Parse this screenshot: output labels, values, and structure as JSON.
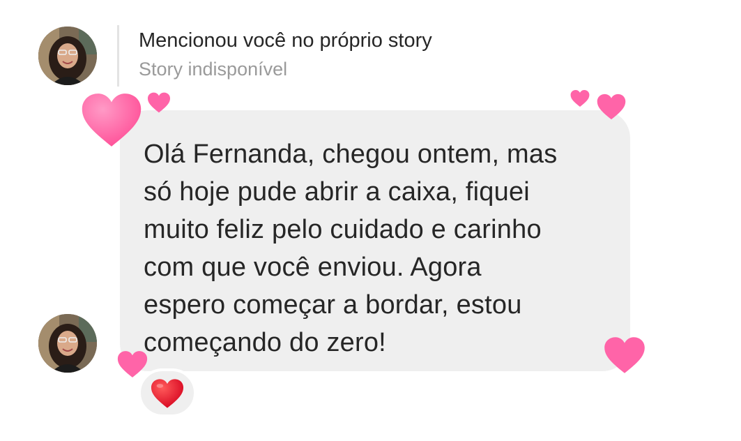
{
  "story": {
    "title": "Mencionou você no próprio story",
    "subtitle": "Story indisponível"
  },
  "message": {
    "text": "Olá Fernanda, chegou ontem, mas\nsó hoje pude abrir a caixa, fiquei\nmuito feliz pelo cuidado e carinho\ncom que você enviou. Agora\nespero começar a bordar, estou\ncomeçando do zero!"
  },
  "reaction": {
    "emoji_icon": "red-heart-icon"
  },
  "colors": {
    "bubble": "#efefef",
    "heart_pink": "#ff5fa2",
    "reaction_red": "#e8102a"
  }
}
